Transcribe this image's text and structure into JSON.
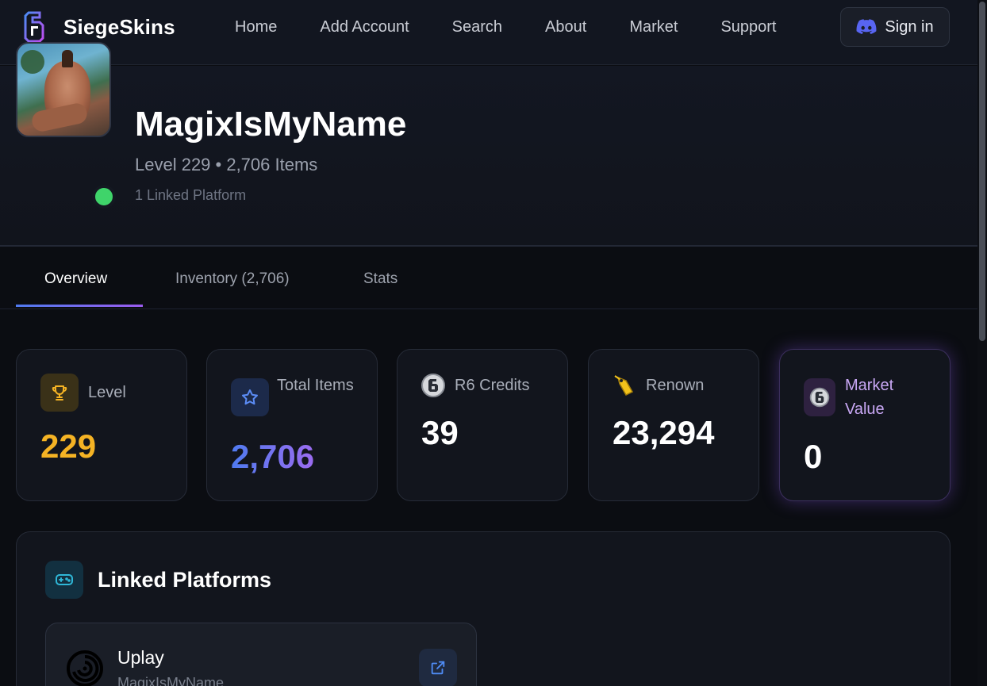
{
  "nav": {
    "brand": "SiegeSkins",
    "links": [
      "Home",
      "Add Account",
      "Search",
      "About",
      "Market",
      "Support"
    ],
    "signin_label": "Sign in"
  },
  "profile": {
    "username": "MagixIsMyName",
    "subline": "Level 229 • 2,706 Items",
    "platforms_count": "1 Linked Platform",
    "status": "online"
  },
  "tabs": [
    {
      "label": "Overview",
      "active": true
    },
    {
      "label": "Inventory (2,706)",
      "active": false
    },
    {
      "label": "Stats",
      "active": false
    }
  ],
  "stats": [
    {
      "label": "Level",
      "value": "229",
      "icon": "trophy-icon",
      "color": "#f5b324"
    },
    {
      "label": "Total Items",
      "value": "2,706",
      "icon": "star-icon",
      "color": "#6f7cf0"
    },
    {
      "label": "R6 Credits",
      "value": "39",
      "icon": "r6-credits-icon",
      "color": "#ffffff"
    },
    {
      "label": "Renown",
      "value": "23,294",
      "icon": "renown-tag-icon",
      "color": "#ffffff"
    },
    {
      "label": "Market Value",
      "value": "0",
      "icon": "r6-logo-icon",
      "color": "#ffffff",
      "label_color": "#c9a8f5"
    }
  ],
  "linked_platforms": {
    "title": "Linked Platforms",
    "items": [
      {
        "name": "Uplay",
        "username": "MagixIsMyName"
      }
    ]
  },
  "colors": {
    "accent_blue": "#4f7bf0",
    "accent_purple": "#9b5cf0",
    "online": "#3fd46a",
    "discord": "#5865f2"
  }
}
